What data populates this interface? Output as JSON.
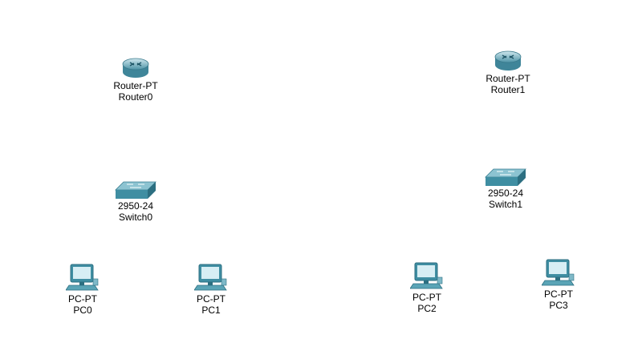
{
  "devices": [
    {
      "id": "router0",
      "type": "router",
      "model": "Router-PT",
      "name": "Router0",
      "icon": "router-icon"
    },
    {
      "id": "router1",
      "type": "router",
      "model": "Router-PT",
      "name": "Router1",
      "icon": "router-icon"
    },
    {
      "id": "switch0",
      "type": "switch",
      "model": "2950-24",
      "name": "Switch0",
      "icon": "switch-icon"
    },
    {
      "id": "switch1",
      "type": "switch",
      "model": "2950-24",
      "name": "Switch1",
      "icon": "switch-icon"
    },
    {
      "id": "pc0",
      "type": "pc",
      "model": "PC-PT",
      "name": "PC0",
      "icon": "pc-icon"
    },
    {
      "id": "pc1",
      "type": "pc",
      "model": "PC-PT",
      "name": "PC1",
      "icon": "pc-icon"
    },
    {
      "id": "pc2",
      "type": "pc",
      "model": "PC-PT",
      "name": "PC2",
      "icon": "pc-icon"
    },
    {
      "id": "pc3",
      "type": "pc",
      "model": "PC-PT",
      "name": "PC3",
      "icon": "pc-icon"
    }
  ],
  "colors": {
    "device_teal": "#3a8fa3",
    "device_light": "#a9d6e0",
    "background": "#ffffff"
  }
}
